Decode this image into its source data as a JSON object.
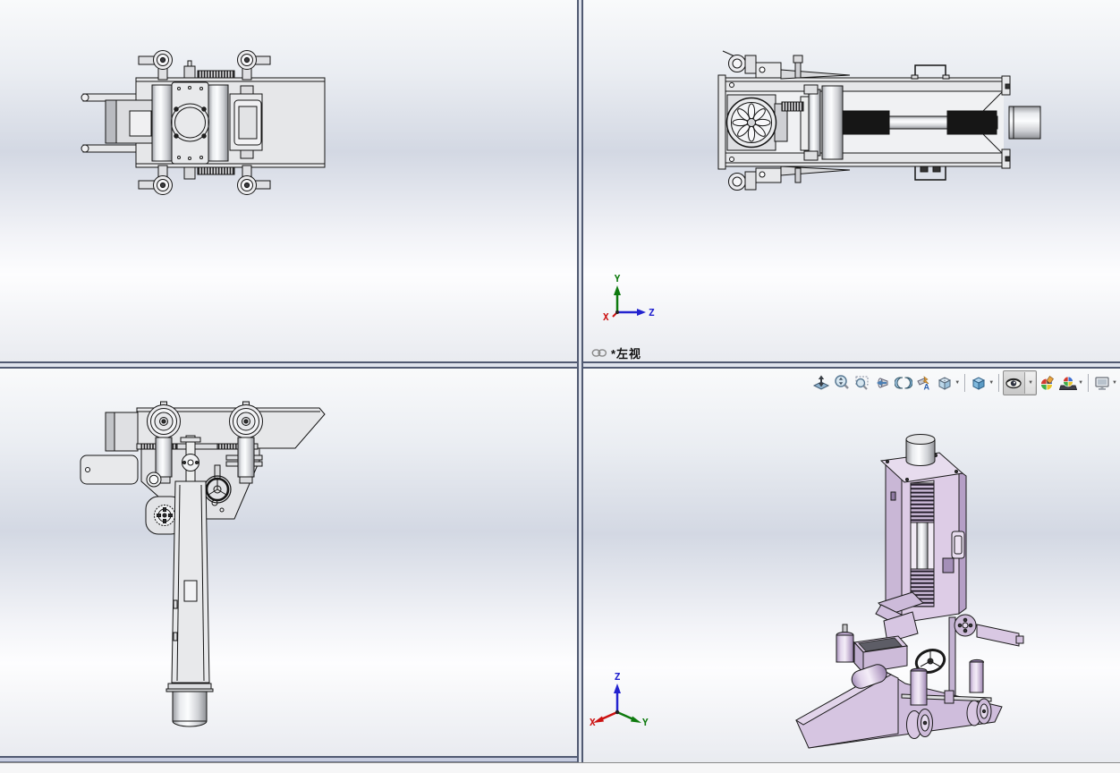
{
  "viewports": {
    "top_left": {
      "view_name": "top view"
    },
    "top_right": {
      "view_name": "left view"
    },
    "bottom_left": {
      "view_name": "front view"
    },
    "bottom_right": {
      "view_name": "isometric view"
    }
  },
  "view_label": {
    "icon": "link-icon",
    "text": "*左视"
  },
  "triads": {
    "orthographic": {
      "up": "Y",
      "right": "Z",
      "toward_viewer": "X"
    },
    "isometric": {
      "up": "Z",
      "down_left": "X",
      "down_right": "Y"
    }
  },
  "toolbar": {
    "annotation_letter": "A",
    "buttons": [
      {
        "name": "zoom-to-fit",
        "dropdown": false,
        "pressed": false
      },
      {
        "name": "zoom-in-out",
        "dropdown": false,
        "pressed": false
      },
      {
        "name": "zoom-to-area",
        "dropdown": false,
        "pressed": false
      },
      {
        "name": "previous-view",
        "dropdown": false,
        "pressed": false
      },
      {
        "name": "section-view",
        "dropdown": false,
        "pressed": false
      },
      {
        "name": "dynamic-annotation-views",
        "dropdown": false,
        "pressed": false
      },
      {
        "name": "view-orientation",
        "dropdown": true,
        "pressed": false
      },
      {
        "name": "display-style",
        "dropdown": true,
        "pressed": false
      },
      {
        "name": "hide-show-items",
        "dropdown": true,
        "pressed": true
      },
      {
        "name": "edit-appearance",
        "dropdown": false,
        "pressed": false
      },
      {
        "name": "apply-scene",
        "dropdown": true,
        "pressed": false
      },
      {
        "name": "view-settings",
        "dropdown": true,
        "pressed": false
      }
    ]
  },
  "colors": {
    "axis_x": "#cc1111",
    "axis_y": "#0e7a0e",
    "axis_z": "#2323cf",
    "ortho_model_fill": "#e6e7e9",
    "iso_model_fill": "#d9c8e3",
    "splitter_line": "#515a72",
    "splitter_fill": "#dfe3ec",
    "background_band": "#d3d8e3"
  }
}
